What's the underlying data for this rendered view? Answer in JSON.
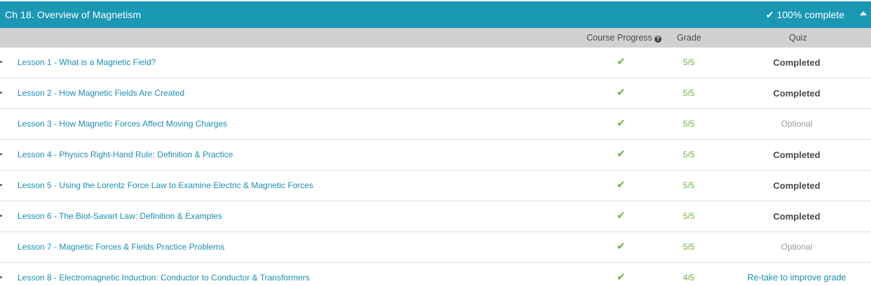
{
  "chapter": {
    "title": "Ch 18. Overview of Magnetism",
    "completion": "100% complete",
    "accent_color": "#1a98b4"
  },
  "columns": {
    "progress": "Course Progress",
    "grade": "Grade",
    "quiz": "Quiz"
  },
  "icons": {
    "complete_check": "✔",
    "help": "?",
    "progress_check": "✔"
  },
  "lessons": [
    {
      "title": "Lesson 1 - What is a Magnetic Field?",
      "bullet": true,
      "grade": "5/5",
      "quiz": "Completed",
      "quiz_status": "completed"
    },
    {
      "title": "Lesson 2 - How Magnetic Fields Are Created",
      "bullet": true,
      "grade": "5/5",
      "quiz": "Completed",
      "quiz_status": "completed"
    },
    {
      "title": "Lesson 3 - How Magnetic Forces Affect Moving Charges",
      "bullet": false,
      "grade": "5/5",
      "quiz": "Optional",
      "quiz_status": "optional"
    },
    {
      "title": "Lesson 4 - Physics Right-Hand Rule: Definition & Practice",
      "bullet": true,
      "grade": "5/5",
      "quiz": "Completed",
      "quiz_status": "completed"
    },
    {
      "title": "Lesson 5 - Using the Lorentz Force Law to Examine Electric & Magnetic Forces",
      "bullet": true,
      "grade": "5/5",
      "quiz": "Completed",
      "quiz_status": "completed"
    },
    {
      "title": "Lesson 6 - The Biot-Savart Law: Definition & Examples",
      "bullet": true,
      "grade": "5/5",
      "quiz": "Completed",
      "quiz_status": "completed"
    },
    {
      "title": "Lesson 7 - Magnetic Forces & Fields Practice Problems",
      "bullet": false,
      "grade": "5/5",
      "quiz": "Optional",
      "quiz_status": "optional"
    },
    {
      "title": "Lesson 8 - Electromagnetic Induction: Conductor to Conductor & Transformers",
      "bullet": true,
      "grade": "4/5",
      "quiz": "Re-take to improve grade",
      "quiz_status": "retake"
    }
  ]
}
